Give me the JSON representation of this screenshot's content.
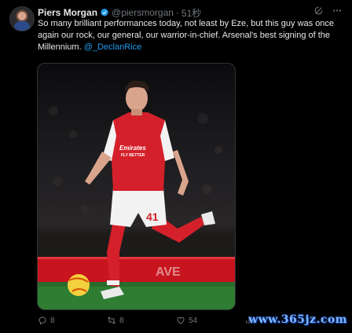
{
  "author": {
    "name": "Piers Morgan",
    "handle": "@piersmorgan",
    "separator": "·",
    "time": "51秒"
  },
  "tweet": {
    "text": "So many brilliant performances today, not least by Eze, but this guy was once again our rock, our general, our warrior-in-chief. Arsenal's best signing of the Millennium. ",
    "mention": "@_DeclanRice"
  },
  "media": {
    "jersey_brand": "Emirates",
    "jersey_sponsor": "FLY BETTER",
    "shirt_number": "41",
    "colors": {
      "shirt": "#d4202a",
      "shorts": "#f2f2f2",
      "pitch": "#2e7d32"
    }
  },
  "actions": {
    "replies": "8",
    "reposts": "8",
    "likes": "54"
  },
  "watermark": "www.365jz.com",
  "colors": {
    "background": "#000000",
    "text": "#e7e9ea",
    "muted": "#71767b",
    "link": "#1d9bf0"
  },
  "icons": [
    "verified-badge-icon",
    "grok-icon",
    "more-icon",
    "reply-icon",
    "repost-icon",
    "like-icon",
    "views-icon"
  ]
}
